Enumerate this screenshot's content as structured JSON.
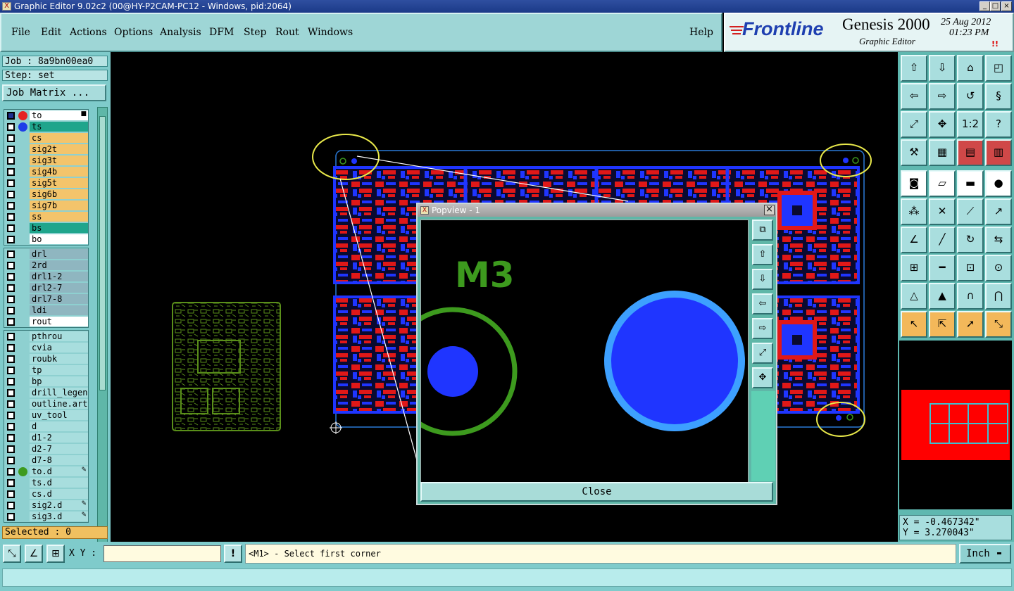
{
  "window": {
    "title": "Graphic Editor 9.02c2 (00@HY-P2CAM-PC12 - Windows, pid:2064)",
    "title_icon": "x-app-icon",
    "controls": [
      "_",
      "□",
      "×"
    ]
  },
  "menu": {
    "items": [
      "File",
      "Edit",
      "Actions",
      "Options",
      "Analysis",
      "DFM",
      "Step",
      "Rout",
      "Windows"
    ],
    "help": "Help"
  },
  "brand": {
    "logo": "Frontline",
    "product": "Genesis 2000",
    "subtitle": "Graphic Editor",
    "date": "25 Aug 2012",
    "time": "01:23 PM",
    "indicator": "!!"
  },
  "left": {
    "job": "Job : 8a9bn00ea0",
    "step": "Step: set",
    "job_matrix": "Job Matrix ...",
    "selected": "Selected : 0",
    "group1": [
      {
        "name": "to",
        "bg": "#ffffff",
        "dot": "#e52222",
        "checked": true,
        "mark": "■"
      },
      {
        "name": "ts",
        "bg": "#1fa58c",
        "dot": "#1f3ee8",
        "checked": false,
        "mark": ""
      },
      {
        "name": "cs",
        "bg": "#f3c46b",
        "dot": "",
        "checked": false,
        "mark": ""
      },
      {
        "name": "sig2t",
        "bg": "#f3c46b",
        "dot": "",
        "checked": false,
        "mark": ""
      },
      {
        "name": "sig3t",
        "bg": "#f3c46b",
        "dot": "",
        "checked": false,
        "mark": ""
      },
      {
        "name": "sig4b",
        "bg": "#f3c46b",
        "dot": "",
        "checked": false,
        "mark": ""
      },
      {
        "name": "sig5t",
        "bg": "#f3c46b",
        "dot": "",
        "checked": false,
        "mark": ""
      },
      {
        "name": "sig6b",
        "bg": "#f3c46b",
        "dot": "",
        "checked": false,
        "mark": ""
      },
      {
        "name": "sig7b",
        "bg": "#f3c46b",
        "dot": "",
        "checked": false,
        "mark": ""
      },
      {
        "name": "ss",
        "bg": "#f3c46b",
        "dot": "",
        "checked": false,
        "mark": ""
      },
      {
        "name": "bs",
        "bg": "#1fa58c",
        "dot": "",
        "checked": false,
        "mark": ""
      },
      {
        "name": "bo",
        "bg": "#ffffff",
        "dot": "",
        "checked": false,
        "mark": ""
      }
    ],
    "group2": [
      {
        "name": "drl",
        "bg": "#8fb6c0",
        "dot": "",
        "checked": false,
        "mark": ""
      },
      {
        "name": "2rd",
        "bg": "#8fb6c0",
        "dot": "",
        "checked": false,
        "mark": ""
      },
      {
        "name": "drl1-2",
        "bg": "#8fb6c0",
        "dot": "",
        "checked": false,
        "mark": ""
      },
      {
        "name": "drl2-7",
        "bg": "#8fb6c0",
        "dot": "",
        "checked": false,
        "mark": ""
      },
      {
        "name": "drl7-8",
        "bg": "#8fb6c0",
        "dot": "",
        "checked": false,
        "mark": ""
      },
      {
        "name": "ldi",
        "bg": "#8fb6c0",
        "dot": "",
        "checked": false,
        "mark": ""
      },
      {
        "name": "rout",
        "bg": "#ffffff",
        "dot": "",
        "checked": false,
        "mark": ""
      }
    ],
    "group3": [
      {
        "name": "pthrou",
        "bg": "#a8dede",
        "dot": "",
        "checked": false,
        "mark": ""
      },
      {
        "name": "cvia",
        "bg": "#a8dede",
        "dot": "",
        "checked": false,
        "mark": ""
      },
      {
        "name": "roubk",
        "bg": "#a8dede",
        "dot": "",
        "checked": false,
        "mark": ""
      },
      {
        "name": "tp",
        "bg": "#a8dede",
        "dot": "",
        "checked": false,
        "mark": ""
      },
      {
        "name": "bp",
        "bg": "#a8dede",
        "dot": "",
        "checked": false,
        "mark": ""
      },
      {
        "name": "drill_legend",
        "bg": "#a8dede",
        "dot": "",
        "checked": false,
        "mark": ""
      },
      {
        "name": "outline.art",
        "bg": "#a8dede",
        "dot": "",
        "checked": false,
        "mark": ""
      },
      {
        "name": "uv_tool",
        "bg": "#a8dede",
        "dot": "",
        "checked": false,
        "mark": ""
      },
      {
        "name": "d",
        "bg": "#a8dede",
        "dot": "",
        "checked": false,
        "mark": ""
      },
      {
        "name": "d1-2",
        "bg": "#a8dede",
        "dot": "",
        "checked": false,
        "mark": ""
      },
      {
        "name": "d2-7",
        "bg": "#a8dede",
        "dot": "",
        "checked": false,
        "mark": ""
      },
      {
        "name": "d7-8",
        "bg": "#a8dede",
        "dot": "",
        "checked": false,
        "mark": ""
      },
      {
        "name": "to.d",
        "bg": "#a8dede",
        "dot": "#3d9a1e",
        "checked": false,
        "mark": "✎"
      },
      {
        "name": "ts.d",
        "bg": "#a8dede",
        "dot": "",
        "checked": false,
        "mark": ""
      },
      {
        "name": "cs.d",
        "bg": "#a8dede",
        "dot": "",
        "checked": false,
        "mark": ""
      },
      {
        "name": "sig2.d",
        "bg": "#a8dede",
        "dot": "",
        "checked": false,
        "mark": "✎"
      },
      {
        "name": "sig3.d",
        "bg": "#a8dede",
        "dot": "",
        "checked": false,
        "mark": "✎"
      }
    ]
  },
  "toolbox": {
    "buttons": [
      {
        "icon": "layer-up-icon",
        "glyph": "⇧",
        "style": ""
      },
      {
        "icon": "layer-down-icon",
        "glyph": "⇩",
        "style": ""
      },
      {
        "icon": "home-icon",
        "glyph": "⌂",
        "style": ""
      },
      {
        "icon": "window-split-icon",
        "glyph": "◰",
        "style": ""
      },
      {
        "icon": "pan-left-icon",
        "glyph": "⇦",
        "style": ""
      },
      {
        "icon": "pan-right-icon",
        "glyph": "⇨",
        "style": ""
      },
      {
        "icon": "undo-view-icon",
        "glyph": "↺",
        "style": ""
      },
      {
        "icon": "redraw-icon",
        "glyph": "§",
        "style": ""
      },
      {
        "icon": "zoom-fit-icon",
        "glyph": "⤢",
        "style": ""
      },
      {
        "icon": "zoom-center-icon",
        "glyph": "✥",
        "style": ""
      },
      {
        "icon": "scale-1-2-icon",
        "glyph": "1:2",
        "style": ""
      },
      {
        "icon": "help-icon",
        "glyph": "?",
        "style": ""
      },
      {
        "icon": "tools-icon",
        "glyph": "⚒",
        "style": ""
      },
      {
        "icon": "grid-icon",
        "glyph": "▦",
        "style": ""
      },
      {
        "icon": "layers-red-icon",
        "glyph": "▤",
        "style": "r"
      },
      {
        "icon": "layers-red-2-icon",
        "glyph": "▥",
        "style": "r"
      },
      {
        "icon": "pad-icon",
        "glyph": "◙",
        "style": "w"
      },
      {
        "icon": "outline-shape-icon",
        "glyph": "▱",
        "style": "w"
      },
      {
        "icon": "ruler-icon",
        "glyph": "▬",
        "style": "w"
      },
      {
        "icon": "record-icon",
        "glyph": "●",
        "style": "w"
      },
      {
        "icon": "net-nodes-icon",
        "glyph": "⁂",
        "style": ""
      },
      {
        "icon": "cross-icon",
        "glyph": "✕",
        "style": ""
      },
      {
        "icon": "line-red-icon",
        "glyph": "⟋",
        "style": ""
      },
      {
        "icon": "line-arrow-icon",
        "glyph": "↗",
        "style": ""
      },
      {
        "icon": "angle-icon",
        "glyph": "∠",
        "style": ""
      },
      {
        "icon": "diagonal-icon",
        "glyph": "╱",
        "style": ""
      },
      {
        "icon": "arc-icon",
        "glyph": "↻",
        "style": ""
      },
      {
        "icon": "flip-icon",
        "glyph": "⇆",
        "style": ""
      },
      {
        "icon": "pad-add-icon",
        "glyph": "⊞",
        "style": ""
      },
      {
        "icon": "dash-icon",
        "glyph": "━",
        "style": ""
      },
      {
        "icon": "measure-icon",
        "glyph": "⊡",
        "style": ""
      },
      {
        "icon": "pad-group-icon",
        "glyph": "⊙",
        "style": ""
      },
      {
        "icon": "triangle-icon",
        "glyph": "△",
        "style": ""
      },
      {
        "icon": "triangle-blue-icon",
        "glyph": "▲",
        "style": ""
      },
      {
        "icon": "arch-icon",
        "glyph": "∩",
        "style": ""
      },
      {
        "icon": "arch-blue-icon",
        "glyph": "⋂",
        "style": ""
      },
      {
        "icon": "pointer-icon",
        "glyph": "↖",
        "style": "o"
      },
      {
        "icon": "pointer-box-icon",
        "glyph": "⇱",
        "style": "o"
      },
      {
        "icon": "pointer-select-icon",
        "glyph": "➚",
        "style": "o"
      },
      {
        "icon": "connect-icon",
        "glyph": "⤡",
        "style": "o"
      }
    ],
    "coord_x": "X = -0.467342\"",
    "coord_y": "Y = 3.270043\""
  },
  "bottom": {
    "xy_label": "X Y :",
    "xy_value": "",
    "exclaim": "!",
    "prompt": "<M1> - Select first corner",
    "unit": "Inch",
    "unit_arrow": "▬"
  },
  "popview": {
    "title": "Popview - 1",
    "close_label": "Close",
    "close_x": "×",
    "label_m3": "M3",
    "side_buttons": [
      {
        "icon": "zoom-window-icon",
        "glyph": "⧉"
      },
      {
        "icon": "layer-up-icon",
        "glyph": "⇧"
      },
      {
        "icon": "layer-down-icon",
        "glyph": "⇩"
      },
      {
        "icon": "pan-left-icon",
        "glyph": "⇦"
      },
      {
        "icon": "pan-right-icon",
        "glyph": "⇨"
      },
      {
        "icon": "zoom-fit-icon",
        "glyph": "⤢"
      },
      {
        "icon": "zoom-center-icon",
        "glyph": "✥"
      }
    ]
  },
  "colors": {
    "panel": "#7fcbcb",
    "trace_red": "#e01818",
    "trace_blue": "#1f35ff",
    "outline": "#2a7ad8",
    "highlight": "#e8e84a",
    "green": "#3d9a1e",
    "light_blue": "#3da0ff"
  }
}
